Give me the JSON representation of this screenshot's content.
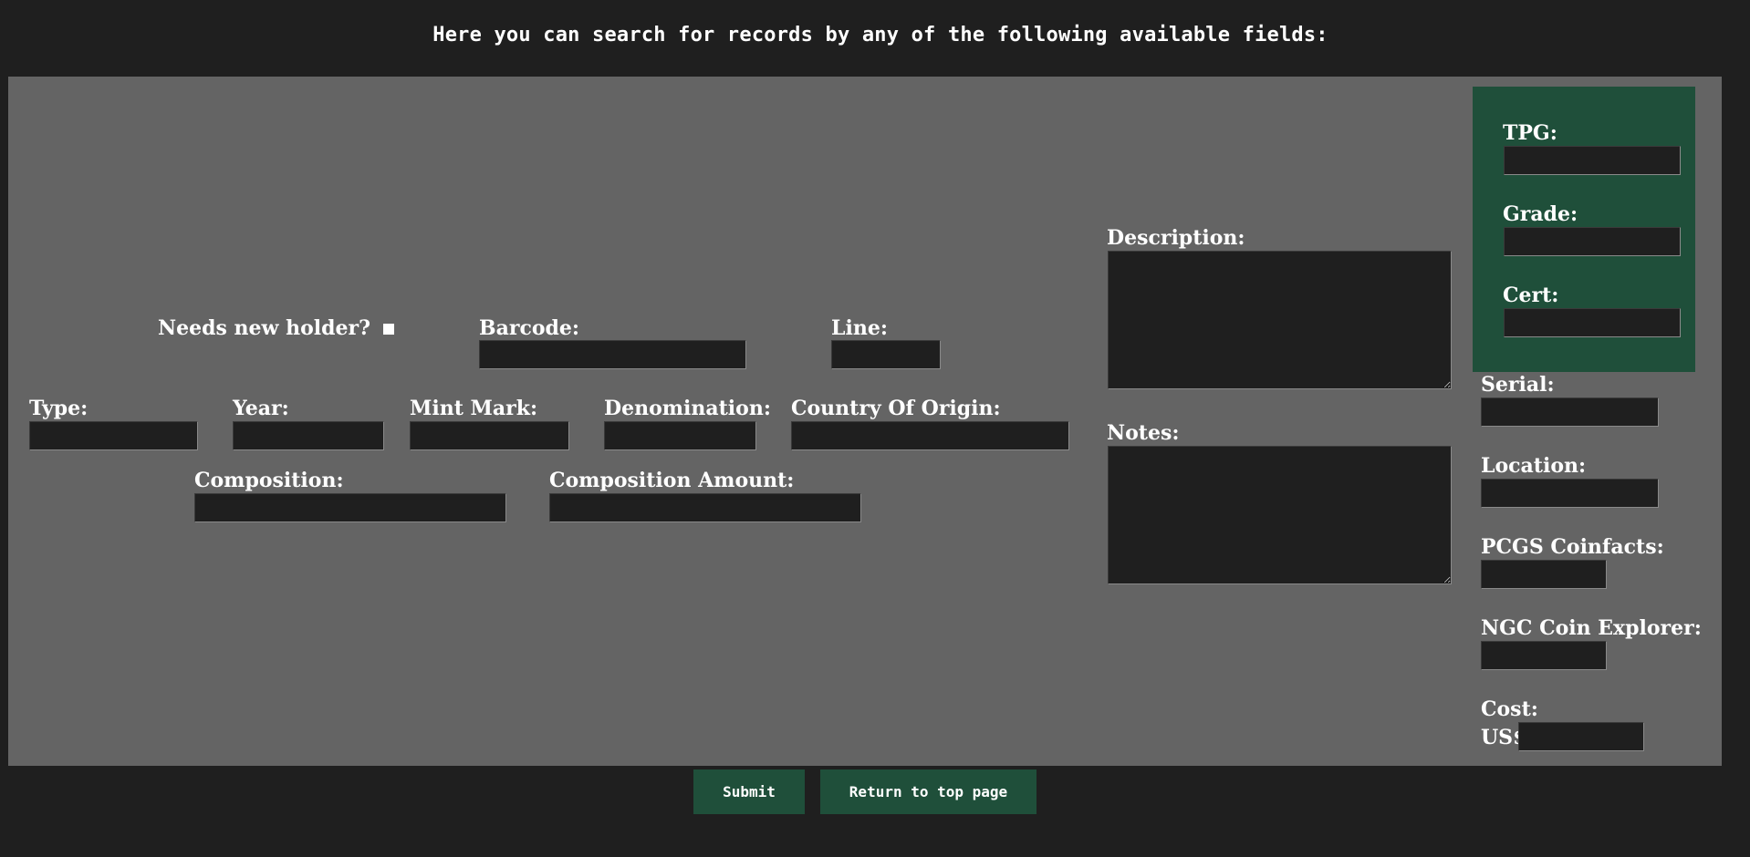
{
  "page": {
    "heading": "Here you can search for records by any of the following available fields:"
  },
  "form": {
    "needs_new_holder_label": "Needs new holder?",
    "barcode_label": "Barcode:",
    "line_label": "Line:",
    "type_label": "Type:",
    "year_label": "Year:",
    "mint_mark_label": "Mint Mark:",
    "denomination_label": "Denomination:",
    "country_label": "Country Of Origin:",
    "composition_label": "Composition:",
    "composition_amount_label": "Composition Amount:",
    "description_label": "Description:",
    "notes_label": "Notes:",
    "tpg_label": "TPG:",
    "grade_label": "Grade:",
    "cert_label": "Cert:",
    "serial_label": "Serial:",
    "location_label": "Location:",
    "pcgs_label": "PCGS Coinfacts:",
    "ngc_label": "NGC Coin Explorer:",
    "cost_label": "Cost:",
    "cost_currency": "US$"
  },
  "buttons": {
    "submit": "Submit",
    "return_top": "Return to top page"
  },
  "colors": {
    "background": "#1f1f1f",
    "panel": "#646464",
    "accent_green": "#1f4f3a",
    "input_bg": "#1f1f1f"
  }
}
